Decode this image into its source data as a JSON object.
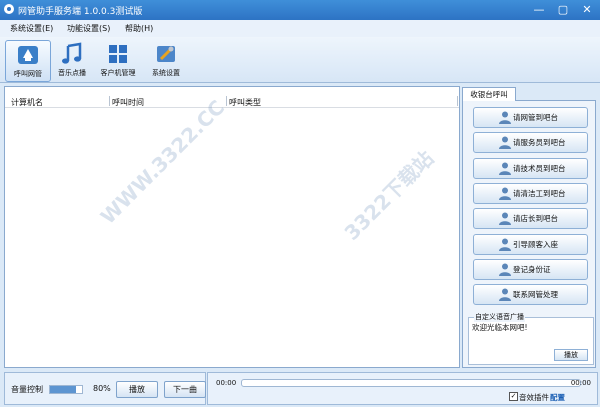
{
  "window": {
    "title": "网管助手服务端 1.0.0.3测试版",
    "minimize": "—",
    "maximize": "▢",
    "close": "✕"
  },
  "menu": [
    "系统设置(E)",
    "功能设置(S)",
    "帮助(H)"
  ],
  "toolbar": [
    {
      "label": "呼叫网管",
      "icon": "call-admin-icon",
      "active": true
    },
    {
      "label": "音乐点播",
      "icon": "music-note-icon"
    },
    {
      "label": "客户机管理",
      "icon": "windows-grid-icon"
    },
    {
      "label": "系统设置",
      "icon": "settings-tools-icon"
    }
  ],
  "table": {
    "columns": [
      "计算机名",
      "呼叫时间",
      "呼叫类型"
    ],
    "rows": []
  },
  "side": {
    "tab": "收银台呼叫",
    "buttons": [
      "请网管到吧台",
      "请服务员到吧台",
      "请技术员到吧台",
      "请清洁工到吧台",
      "请店长到吧台",
      "引导顾客入座",
      "登记身份证",
      "联系网管处理"
    ],
    "custom": {
      "legend": "自定义语音广播",
      "text": "欢迎光临本网吧!",
      "play": "播放"
    }
  },
  "bottom": {
    "volume_label": "音量控制",
    "volume_percent": "80%",
    "volume_value": 0.8,
    "play": "播放",
    "next": "下一曲",
    "time_left": "00:00",
    "time_right": "00:00",
    "progress": 0,
    "plugin_label": "音效插件",
    "plugin_checked": true,
    "config_link": "配置"
  },
  "watermark": "3322下载站",
  "watermark_url": "WWW.3322.CC"
}
